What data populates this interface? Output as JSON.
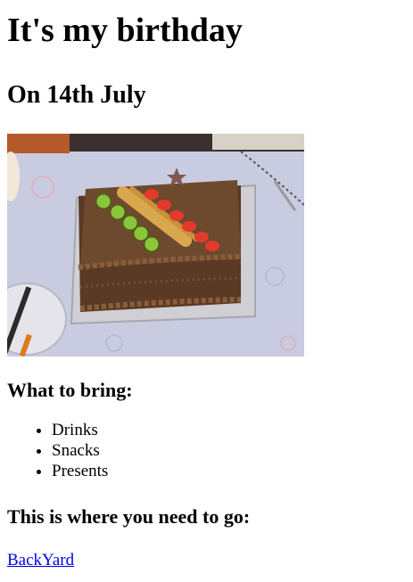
{
  "page": {
    "title": "It's my birthday",
    "subtitle": "On 14th July",
    "bring_heading": "What to bring:",
    "bring_items": [
      "Drinks",
      "Snacks",
      "Presents"
    ],
    "where_heading": "This is where you need to go:",
    "location_link": "BackYard"
  },
  "colors": {
    "link": "#0000ee",
    "text": "#000000",
    "background": "#ffffff"
  }
}
